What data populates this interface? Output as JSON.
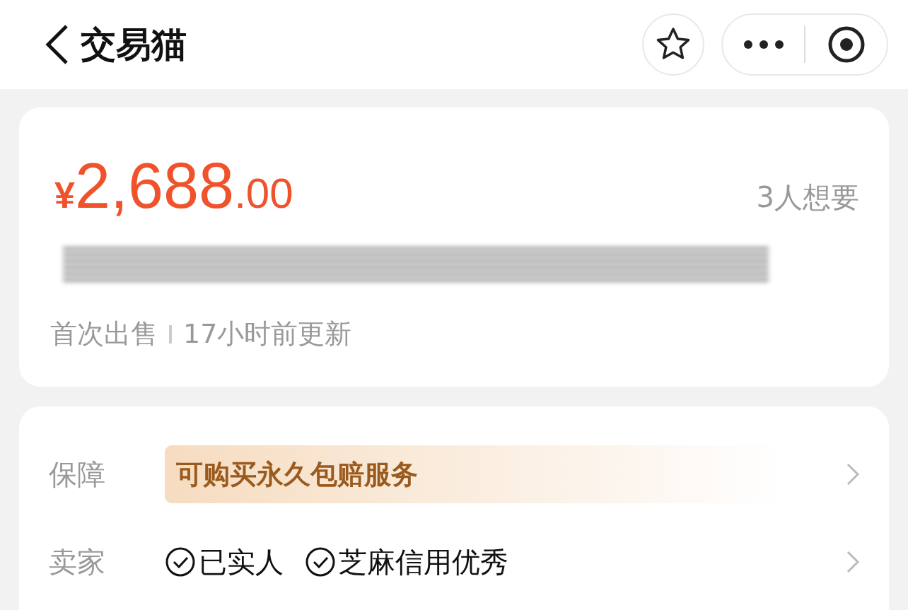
{
  "nav": {
    "title": "交易猫"
  },
  "price": {
    "currency": "¥",
    "integer": "2,688",
    "decimal": ".00",
    "wants": "3人想要"
  },
  "meta": [
    "首次出售",
    "17小时前更新"
  ],
  "rows": [
    {
      "label": "保障",
      "kind": "badge",
      "badge": "可购买永久包赔服务"
    },
    {
      "label": "卖家",
      "kind": "checks",
      "items": [
        "已实人",
        "芝麻信用优秀"
      ]
    }
  ]
}
